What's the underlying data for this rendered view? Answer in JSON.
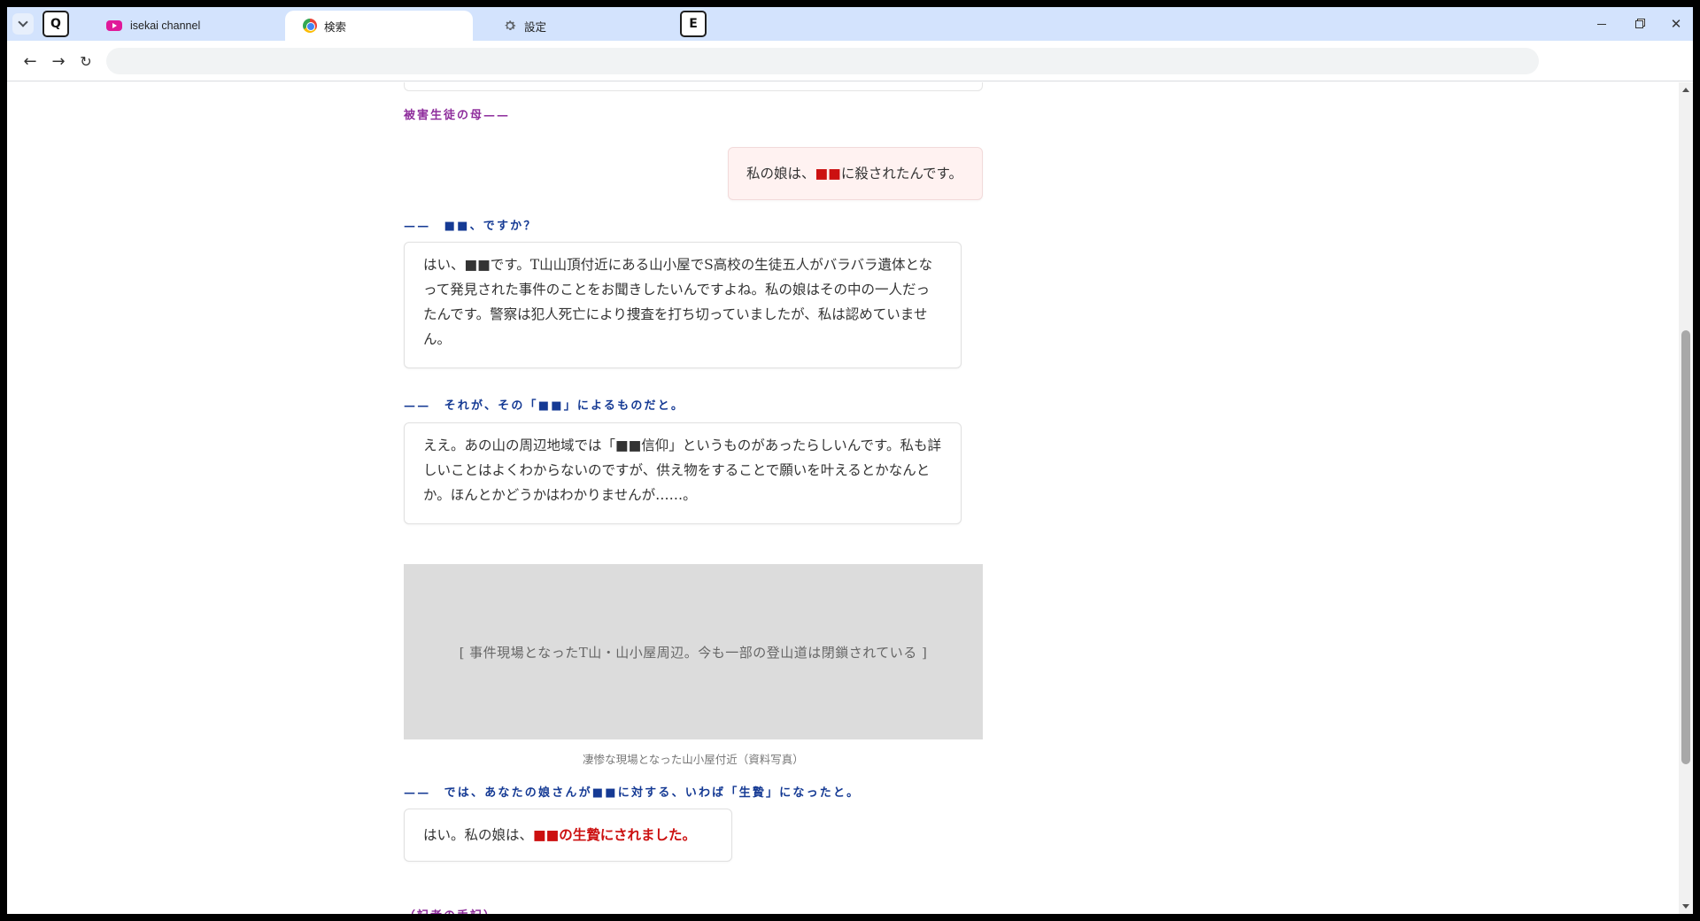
{
  "browser": {
    "tabs": [
      {
        "label": "isekai channel",
        "icon": "youtube-icon"
      },
      {
        "label": "検索",
        "icon": "chrome-icon",
        "active": true
      },
      {
        "label": "設定",
        "icon": "gear-icon"
      }
    ],
    "key_badges": {
      "left": "Q",
      "right": "E"
    },
    "address_value": "",
    "nav": {
      "back": "←",
      "forward": "→",
      "reload": "↻"
    },
    "window": {
      "close": "✕"
    }
  },
  "article": {
    "speaker_mother": "被害生徒の母——",
    "mother_line": {
      "pre": "私の娘は、",
      "redacted": "■■",
      "post": "に殺されたんです。"
    },
    "q1": "——　■■、ですか？",
    "a1": "はい、■■です。T山山頂付近にある山小屋でS高校の生徒五人がバラバラ遺体となって発見された事件のことをお聞きしたいんですよね。私の娘はその中の一人だったんです。警察は犯人死亡により捜査を打ち切っていましたが、私は認めていません。",
    "q2": "——　それが、その「■■」によるものだと。",
    "a2": "ええ。あの山の周辺地域では「■■信仰」というものがあったらしいんです。私も詳しいことはよくわからないのですが、供え物をすることで願いを叶えるとかなんとか。ほんとかどうかはわかりませんが……。",
    "photo_placeholder": "[ 事件現場となったT山・山小屋周辺。今も一部の登山道は閉鎖されている ]",
    "photo_caption": "凄惨な現場となった山小屋付近（資料写真）",
    "q3": "——　では、あなたの娘さんが■■に対する、いわば「生贄」になったと。",
    "a3": {
      "pre": "はい。私の娘は、",
      "emphasis": "■■の生贄にされました。"
    },
    "notes_heading": "（記者の手記）"
  },
  "colors": {
    "tabstrip": "#d3e3fd",
    "speaker_purple": "#8e2d9c",
    "question_blue": "#153a94",
    "redacted_red": "#cc1010"
  }
}
